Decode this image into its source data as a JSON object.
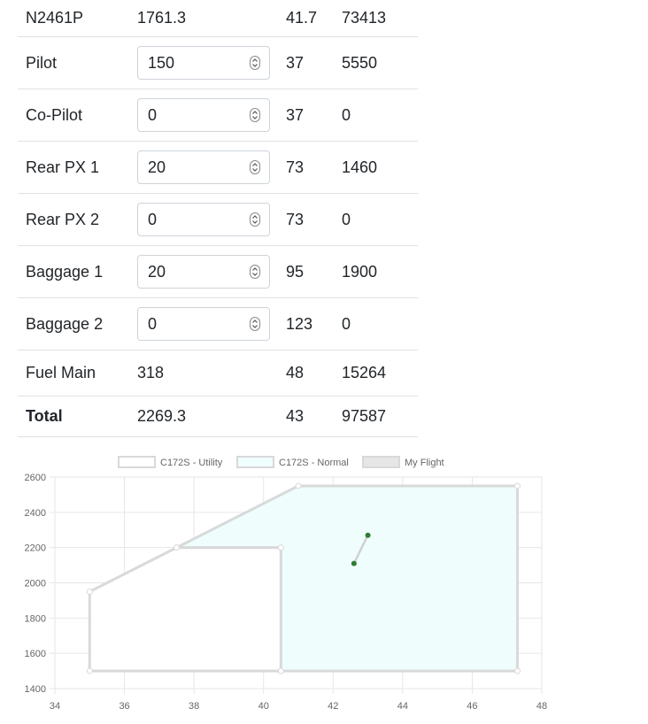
{
  "table": {
    "rows": [
      {
        "label": "N2461P",
        "weight": "1761.3",
        "arm": "41.7",
        "moment": "73413",
        "input": false
      },
      {
        "label": "Pilot",
        "weight": "150",
        "arm": "37",
        "moment": "5550",
        "input": true
      },
      {
        "label": "Co-Pilot",
        "weight": "0",
        "arm": "37",
        "moment": "0",
        "input": true
      },
      {
        "label": "Rear PX 1",
        "weight": "20",
        "arm": "73",
        "moment": "1460",
        "input": true
      },
      {
        "label": "Rear PX 2",
        "weight": "0",
        "arm": "73",
        "moment": "0",
        "input": true
      },
      {
        "label": "Baggage 1",
        "weight": "20",
        "arm": "95",
        "moment": "1900",
        "input": true
      },
      {
        "label": "Baggage 2",
        "weight": "0",
        "arm": "123",
        "moment": "0",
        "input": true
      },
      {
        "label": "Fuel Main",
        "weight": "318",
        "arm": "48",
        "moment": "15264",
        "input": false
      }
    ],
    "total": {
      "label": "Total",
      "weight": "2269.3",
      "arm": "43",
      "moment": "97587"
    }
  },
  "chart_data": {
    "type": "scatter",
    "legend": [
      "C172S - Utility",
      "C172S - Normal",
      "My Flight"
    ],
    "legend_position": "top",
    "grid": true,
    "xlim": [
      34,
      48
    ],
    "ylim": [
      1400,
      2600
    ],
    "x_ticks": [
      "34",
      "36",
      "38",
      "40",
      "42",
      "44",
      "46",
      "48"
    ],
    "y_ticks": [
      "1400",
      "1600",
      "1800",
      "2000",
      "2200",
      "2400",
      "2600"
    ],
    "series": [
      {
        "name": "C172S - Utility",
        "color": "#d9d9d9",
        "fill": "#ffffff",
        "points": [
          [
            35,
            1500
          ],
          [
            35,
            1950
          ],
          [
            37.5,
            2200
          ],
          [
            40.5,
            2200
          ],
          [
            40.5,
            1500
          ]
        ]
      },
      {
        "name": "C172S - Normal",
        "color": "#d9d9d9",
        "fill": "#effdfd",
        "points": [
          [
            40.5,
            1500
          ],
          [
            40.5,
            2200
          ],
          [
            37.5,
            2200
          ],
          [
            41,
            2550
          ],
          [
            47.3,
            2550
          ],
          [
            47.3,
            1500
          ]
        ]
      },
      {
        "name": "My Flight",
        "color": "#2e7d32",
        "points": [
          [
            42.6,
            2110
          ],
          [
            43,
            2270
          ]
        ]
      }
    ]
  }
}
